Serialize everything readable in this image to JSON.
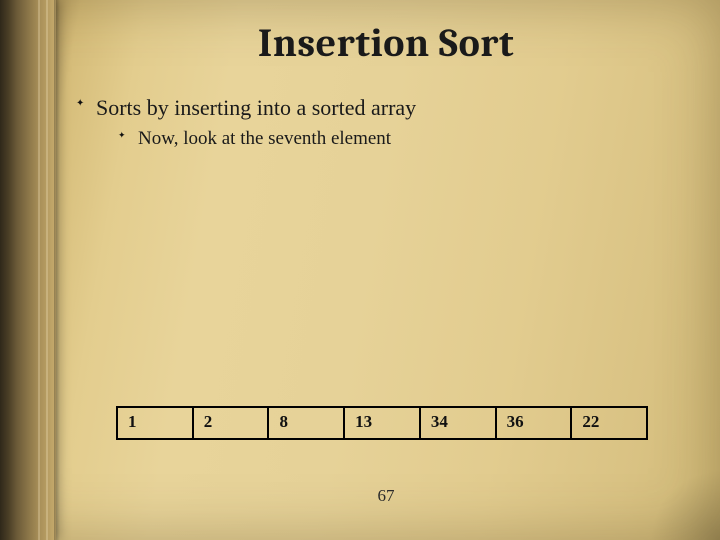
{
  "title": "Insertion Sort",
  "bullet": "Sorts by inserting into a sorted array",
  "subbullet": "Now, look at the seventh element",
  "array": [
    "1",
    "2",
    "8",
    "13",
    "34",
    "36",
    "22"
  ],
  "page_number": "67"
}
